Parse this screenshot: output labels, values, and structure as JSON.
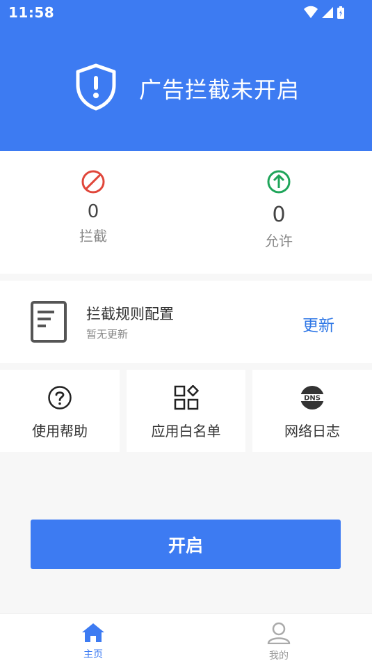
{
  "status_bar": {
    "time": "11:58"
  },
  "header": {
    "title": "广告拦截未开启",
    "background_color": "#3d7bf2",
    "icon": "shield-alert-icon"
  },
  "stats": {
    "block": {
      "value": "0",
      "label": "拦截",
      "icon": "prohibited-icon",
      "color": "#e0463a"
    },
    "allow": {
      "value": "0",
      "label": "允许",
      "icon": "arrow-up-circle-icon",
      "color": "#1fa55a"
    }
  },
  "rules": {
    "title": "拦截规则配置",
    "subtitle": "暂无更新",
    "action_label": "更新",
    "action_color": "#2f77e6",
    "icon": "document-icon"
  },
  "tools": [
    {
      "label": "使用帮助",
      "icon": "question-circle-icon"
    },
    {
      "label": "应用白名单",
      "icon": "app-grid-icon"
    },
    {
      "label": "网络日志",
      "icon": "dns-icon"
    }
  ],
  "main_action": {
    "label": "开启",
    "color": "#3d7bf2"
  },
  "bottom_nav": {
    "items": [
      {
        "label": "主页",
        "icon": "home-icon",
        "active": true
      },
      {
        "label": "我的",
        "icon": "person-icon",
        "active": false
      }
    ]
  }
}
